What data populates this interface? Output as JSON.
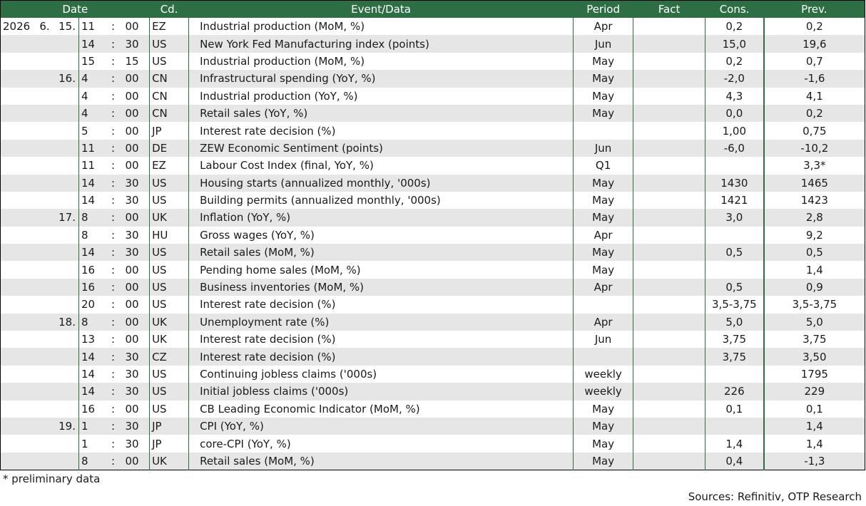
{
  "headers": {
    "date": "Date",
    "code": "Cd.",
    "event": "Event/Data",
    "period": "Period",
    "fact": "Fact",
    "cons": "Cons.",
    "prev": "Prev."
  },
  "rows": [
    {
      "y": "2026",
      "mo": "6.",
      "d": "15.",
      "h": "11",
      "m": "00",
      "cd": "EZ",
      "ev": "Industrial production (MoM, %)",
      "per": "Apr",
      "fact": "",
      "cons": "0,2",
      "prev": "0,2"
    },
    {
      "y": "",
      "mo": "",
      "d": "",
      "h": "14",
      "m": "30",
      "cd": "US",
      "ev": "New York Fed Manufacturing index (points)",
      "per": "Jun",
      "fact": "",
      "cons": "15,0",
      "prev": "19,6"
    },
    {
      "y": "",
      "mo": "",
      "d": "",
      "h": "15",
      "m": "15",
      "cd": "US",
      "ev": "Industrial production (MoM, %)",
      "per": "May",
      "fact": "",
      "cons": "0,2",
      "prev": "0,7"
    },
    {
      "y": "",
      "mo": "",
      "d": "16.",
      "h": "4",
      "m": "00",
      "cd": "CN",
      "ev": "Infrastructural spending (YoY, %)",
      "per": "May",
      "fact": "",
      "cons": "-2,0",
      "prev": "-1,6"
    },
    {
      "y": "",
      "mo": "",
      "d": "",
      "h": "4",
      "m": "00",
      "cd": "CN",
      "ev": "Industrial production (YoY, %)",
      "per": "May",
      "fact": "",
      "cons": "4,3",
      "prev": "4,1"
    },
    {
      "y": "",
      "mo": "",
      "d": "",
      "h": "4",
      "m": "00",
      "cd": "CN",
      "ev": "Retail sales (YoY, %)",
      "per": "May",
      "fact": "",
      "cons": "0,0",
      "prev": "0,2"
    },
    {
      "y": "",
      "mo": "",
      "d": "",
      "h": "5",
      "m": "00",
      "cd": "JP",
      "ev": "Interest rate decision (%)",
      "per": "",
      "fact": "",
      "cons": "1,00",
      "prev": "0,75"
    },
    {
      "y": "",
      "mo": "",
      "d": "",
      "h": "11",
      "m": "00",
      "cd": "DE",
      "ev": "ZEW Economic Sentiment (points)",
      "per": "Jun",
      "fact": "",
      "cons": "-6,0",
      "prev": "-10,2"
    },
    {
      "y": "",
      "mo": "",
      "d": "",
      "h": "11",
      "m": "00",
      "cd": "EZ",
      "ev": "Labour Cost Index (final, YoY, %)",
      "per": "Q1",
      "fact": "",
      "cons": "",
      "prev": "3,3*"
    },
    {
      "y": "",
      "mo": "",
      "d": "",
      "h": "14",
      "m": "30",
      "cd": "US",
      "ev": "Housing starts (annualized monthly, '000s)",
      "per": "May",
      "fact": "",
      "cons": "1430",
      "prev": "1465"
    },
    {
      "y": "",
      "mo": "",
      "d": "",
      "h": "14",
      "m": "30",
      "cd": "US",
      "ev": "Building permits (annualized monthly, '000s)",
      "per": "May",
      "fact": "",
      "cons": "1421",
      "prev": "1423"
    },
    {
      "y": "",
      "mo": "",
      "d": "17.",
      "h": "8",
      "m": "00",
      "cd": "UK",
      "ev": "Inflation (YoY, %)",
      "per": "May",
      "fact": "",
      "cons": "3,0",
      "prev": "2,8"
    },
    {
      "y": "",
      "mo": "",
      "d": "",
      "h": "8",
      "m": "30",
      "cd": "HU",
      "ev": "Gross wages (YoY, %)",
      "per": "Apr",
      "fact": "",
      "cons": "",
      "prev": "9,2"
    },
    {
      "y": "",
      "mo": "",
      "d": "",
      "h": "14",
      "m": "30",
      "cd": "US",
      "ev": "Retail sales (MoM, %)",
      "per": "May",
      "fact": "",
      "cons": "0,5",
      "prev": "0,5"
    },
    {
      "y": "",
      "mo": "",
      "d": "",
      "h": "16",
      "m": "00",
      "cd": "US",
      "ev": "Pending home sales (MoM, %)",
      "per": "May",
      "fact": "",
      "cons": "",
      "prev": "1,4"
    },
    {
      "y": "",
      "mo": "",
      "d": "",
      "h": "16",
      "m": "00",
      "cd": "US",
      "ev": "Business inventories (MoM, %)",
      "per": "Apr",
      "fact": "",
      "cons": "0,5",
      "prev": "0,9"
    },
    {
      "y": "",
      "mo": "",
      "d": "",
      "h": "20",
      "m": "00",
      "cd": "US",
      "ev": "Interest rate decision (%)",
      "per": "",
      "fact": "",
      "cons": "3,5-3,75",
      "prev": "3,5-3,75"
    },
    {
      "y": "",
      "mo": "",
      "d": "18.",
      "h": "8",
      "m": "00",
      "cd": "UK",
      "ev": "Unemployment rate (%)",
      "per": "Apr",
      "fact": "",
      "cons": "5,0",
      "prev": "5,0"
    },
    {
      "y": "",
      "mo": "",
      "d": "",
      "h": "13",
      "m": "00",
      "cd": "UK",
      "ev": "Interest rate decision (%)",
      "per": "Jun",
      "fact": "",
      "cons": "3,75",
      "prev": "3,75"
    },
    {
      "y": "",
      "mo": "",
      "d": "",
      "h": "14",
      "m": "30",
      "cd": "CZ",
      "ev": "Interest rate decision (%)",
      "per": "",
      "fact": "",
      "cons": "3,75",
      "prev": "3,50"
    },
    {
      "y": "",
      "mo": "",
      "d": "",
      "h": "14",
      "m": "30",
      "cd": "US",
      "ev": "Continuing jobless claims ('000s)",
      "per": "weekly",
      "fact": "",
      "cons": "",
      "prev": "1795"
    },
    {
      "y": "",
      "mo": "",
      "d": "",
      "h": "14",
      "m": "30",
      "cd": "US",
      "ev": "Initial jobless claims ('000s)",
      "per": "weekly",
      "fact": "",
      "cons": "226",
      "prev": "229"
    },
    {
      "y": "",
      "mo": "",
      "d": "",
      "h": "16",
      "m": "00",
      "cd": "US",
      "ev": "CB Leading Economic Indicator (MoM, %)",
      "per": "May",
      "fact": "",
      "cons": "0,1",
      "prev": "0,1"
    },
    {
      "y": "",
      "mo": "",
      "d": "19.",
      "h": "1",
      "m": "30",
      "cd": "JP",
      "ev": "CPI (YoY, %)",
      "per": "May",
      "fact": "",
      "cons": "",
      "prev": "1,4"
    },
    {
      "y": "",
      "mo": "",
      "d": "",
      "h": "1",
      "m": "30",
      "cd": "JP",
      "ev": "core-CPI (YoY, %)",
      "per": "May",
      "fact": "",
      "cons": "1,4",
      "prev": "1,4"
    },
    {
      "y": "",
      "mo": "",
      "d": "",
      "h": "8",
      "m": "00",
      "cd": "UK",
      "ev": "Retail sales (MoM, %)",
      "per": "May",
      "fact": "",
      "cons": "0,4",
      "prev": "-1,3"
    }
  ],
  "time_separator": ":",
  "footnote": "* preliminary data",
  "source": "Sources: Refinitiv, OTP Research"
}
